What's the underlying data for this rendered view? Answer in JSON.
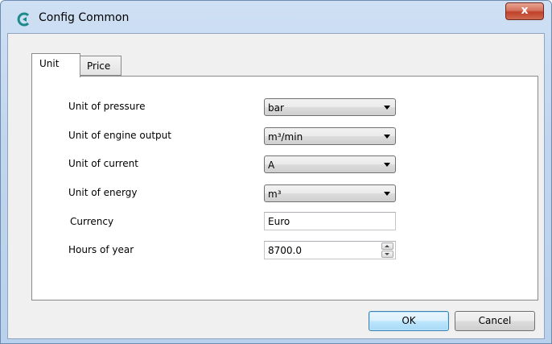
{
  "window": {
    "title": "Config Common",
    "close_label": "x"
  },
  "tabs": [
    {
      "label": "Unit",
      "selected": true
    },
    {
      "label": "Price",
      "selected": false
    }
  ],
  "unit_panel": {
    "pressure": {
      "label": "Unit of pressure",
      "value": "bar"
    },
    "engine_output": {
      "label": "Unit of engine output",
      "value": "m³/min"
    },
    "current": {
      "label": "Unit of current",
      "value": "A"
    },
    "energy": {
      "label": "Unit of energy",
      "value": "m³"
    },
    "currency": {
      "label": "Currency",
      "value": "Euro"
    },
    "hours_of_year": {
      "label": "Hours of year",
      "value": "8700.0"
    }
  },
  "buttons": {
    "ok": "OK",
    "cancel": "Cancel"
  },
  "colors": {
    "title_bar": "#c1d6ee",
    "close_button": "#c0412a",
    "ok_button_border": "#3c7fb1",
    "panel_background": "#ffffff",
    "dialog_background": "#f0f0f0"
  },
  "icons": {
    "app": "app-logo-icon",
    "close": "close-icon",
    "dropdown": "chevron-down-icon",
    "spin_up": "spin-up-icon",
    "spin_down": "spin-down-icon"
  }
}
